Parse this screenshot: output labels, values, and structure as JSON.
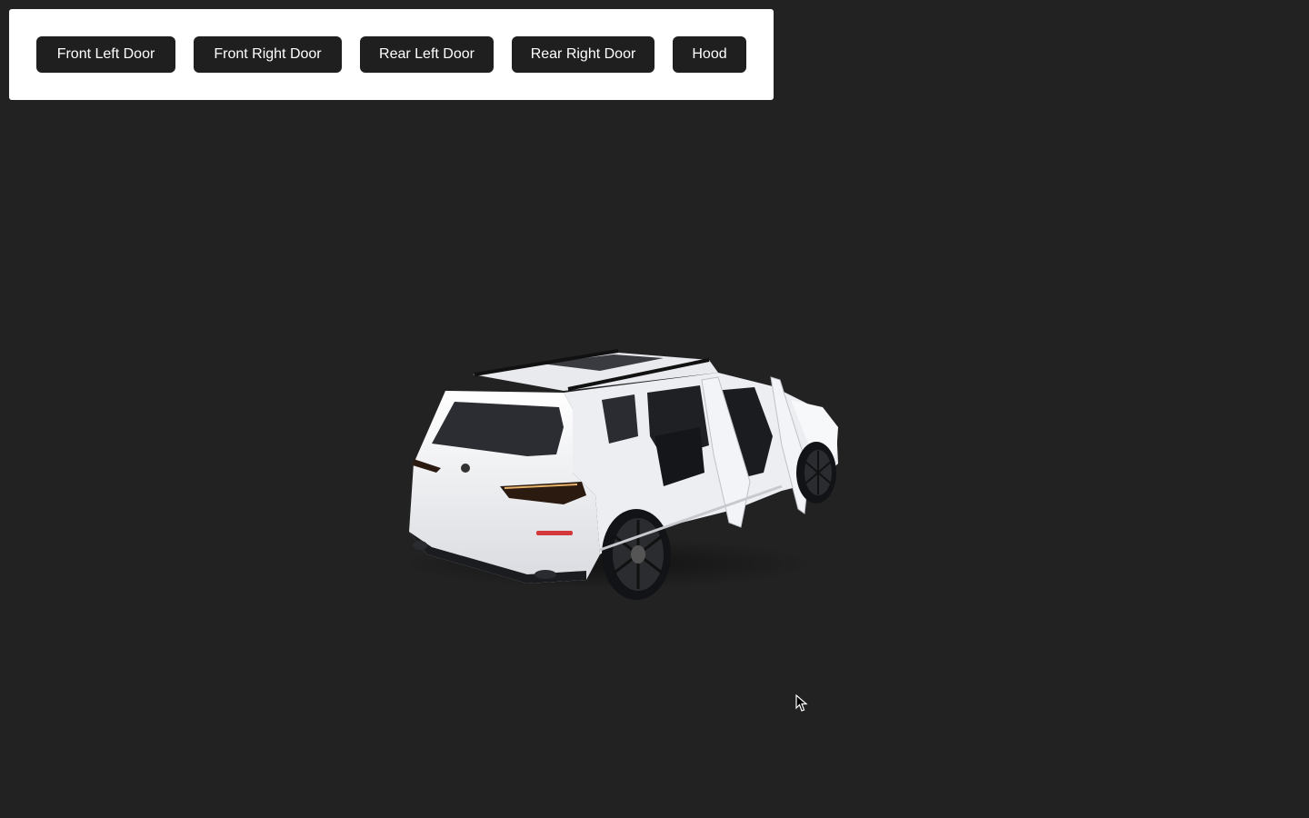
{
  "toolbar": {
    "buttons": [
      {
        "label": "Front Left Door"
      },
      {
        "label": "Front Right Door"
      },
      {
        "label": "Rear Left Door"
      },
      {
        "label": "Rear Right Door"
      },
      {
        "label": "Hood"
      }
    ]
  },
  "scene": {
    "background_color": "#222222",
    "model_icon": "suv-3d-model",
    "body_color": "#f1f1f3"
  },
  "cursor": {
    "icon": "arrow-pointer-icon"
  }
}
